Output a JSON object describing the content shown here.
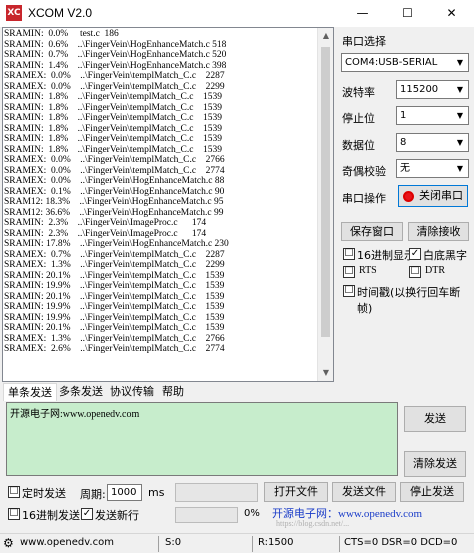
{
  "window": {
    "title": "XCOM V2.0",
    "min": "—",
    "max": "☐",
    "close": "✕",
    "app_icon_text": "XC"
  },
  "receive": {
    "lines": [
      "SRAMIN:  0.0%     test.c  186",
      "SRAMIN:  0.6%    ..\\FingerVein\\HogEnhanceMatch.c 518",
      "SRAMIN:  0.7%    ..\\FingerVein\\HogEnhanceMatch.c 520",
      "SRAMIN:  1.4%    ..\\FingerVein\\HogEnhanceMatch.c 398",
      "SRAMEX:  0.0%    ..\\FingerVein\\templMatch_C.c    2287",
      "SRAMEX:  0.0%    ..\\FingerVein\\templMatch_C.c    2299",
      "SRAMIN:  1.8%    ..\\FingerVein\\templMatch_C.c    1539",
      "SRAMIN:  1.8%    ..\\FingerVein\\templMatch_C.c    1539",
      "SRAMIN:  1.8%    ..\\FingerVein\\templMatch_C.c    1539",
      "SRAMIN:  1.8%    ..\\FingerVein\\templMatch_C.c    1539",
      "SRAMIN:  1.8%    ..\\FingerVein\\templMatch_C.c    1539",
      "SRAMIN:  1.8%    ..\\FingerVein\\templMatch_C.c    1539",
      "SRAMEX:  0.0%    ..\\FingerVein\\templMatch_C.c    2766",
      "SRAMEX:  0.0%    ..\\FingerVein\\templMatch_C.c    2774",
      "SRAMEX:  0.0%    ..\\FingerVein\\HogEnhanceMatch.c 88",
      "SRAMEX:  0.1%    ..\\FingerVein\\HogEnhanceMatch.c 90",
      "SRAM12: 18.3%    ..\\FingerVein\\HogEnhanceMatch.c 95",
      "SRAM12: 36.6%    ..\\FingerVein\\HogEnhanceMatch.c 99",
      "SRAMIN:  2.3%    ..\\FingerVein\\ImageProc.c      174",
      "SRAMIN:  2.3%    ..\\FingerVein\\ImageProc.c      174",
      "SRAMIN: 17.8%    ..\\FingerVein\\HogEnhanceMatch.c 230",
      "SRAMEX:  0.7%    ..\\FingerVein\\templMatch_C.c    2287",
      "SRAMEX:  1.3%    ..\\FingerVein\\templMatch_C.c    2299",
      "SRAMIN: 20.1%    ..\\FingerVein\\templMatch_C.c    1539",
      "SRAMIN: 19.9%    ..\\FingerVein\\templMatch_C.c    1539",
      "SRAMIN: 20.1%    ..\\FingerVein\\templMatch_C.c    1539",
      "SRAMIN: 19.9%    ..\\FingerVein\\templMatch_C.c    1539",
      "SRAMIN: 19.9%    ..\\FingerVein\\templMatch_C.c    1539",
      "SRAMIN: 20.1%    ..\\FingerVein\\templMatch_C.c    1539",
      "SRAMEX:  1.3%    ..\\FingerVein\\templMatch_C.c    2766",
      "SRAMEX:  2.6%    ..\\FingerVein\\templMatch_C.c    2774"
    ]
  },
  "port": {
    "section_label": "串口选择",
    "port_value": "COM4:USB-SERIAL",
    "baud_label": "波特率",
    "baud_value": "115200",
    "stop_label": "停止位",
    "stop_value": "1",
    "data_label": "数据位",
    "data_value": "8",
    "parity_label": "奇偶校验",
    "parity_value": "无",
    "op_label": "串口操作",
    "close_port_label": "关闭串口",
    "led_color": "#e8141a"
  },
  "right_buttons": {
    "save_window": "保存窗口",
    "clear_receive": "清除接收"
  },
  "options": {
    "hex_display": {
      "label": "16进制显示",
      "checked": "☐"
    },
    "white_bg": {
      "label": "白底黑字",
      "checked": "✓"
    },
    "rts": {
      "label": "RTS",
      "checked": "☐"
    },
    "dtr": {
      "label": "DTR",
      "checked": "☐"
    },
    "timestamp": {
      "label": "时间戳(以换行回车断帧)",
      "checked": "☐"
    }
  },
  "tabs": [
    "单条发送",
    "多条发送",
    "协议传输",
    "帮助"
  ],
  "send": {
    "text": "开源电子网:www.openedv.com",
    "send_button": "发送",
    "clear_send_button": "清除发送"
  },
  "bottom": {
    "timed_send_label": "定时发送",
    "timed_send_checked": "☐",
    "period_label": "周期:",
    "period_value": "1000",
    "ms_label": "ms",
    "hex_send_label": "16进制发送",
    "hex_send_checked": "☐",
    "newline_label": "发送新行",
    "newline_checked": "✓",
    "open_file": "打开文件",
    "send_file": "发送文件",
    "stop_send": "停止发送",
    "progress_text": "0%",
    "watermark": "开源电子网：www.openedv.com",
    "watermark2": "https://blog.csdn.net/..."
  },
  "statusbar": {
    "gear": "⚙",
    "url": "www.openedv.com",
    "s": "S:0",
    "r": "R:1500",
    "signals": "CTS=0 DSR=0 DCD=0"
  }
}
